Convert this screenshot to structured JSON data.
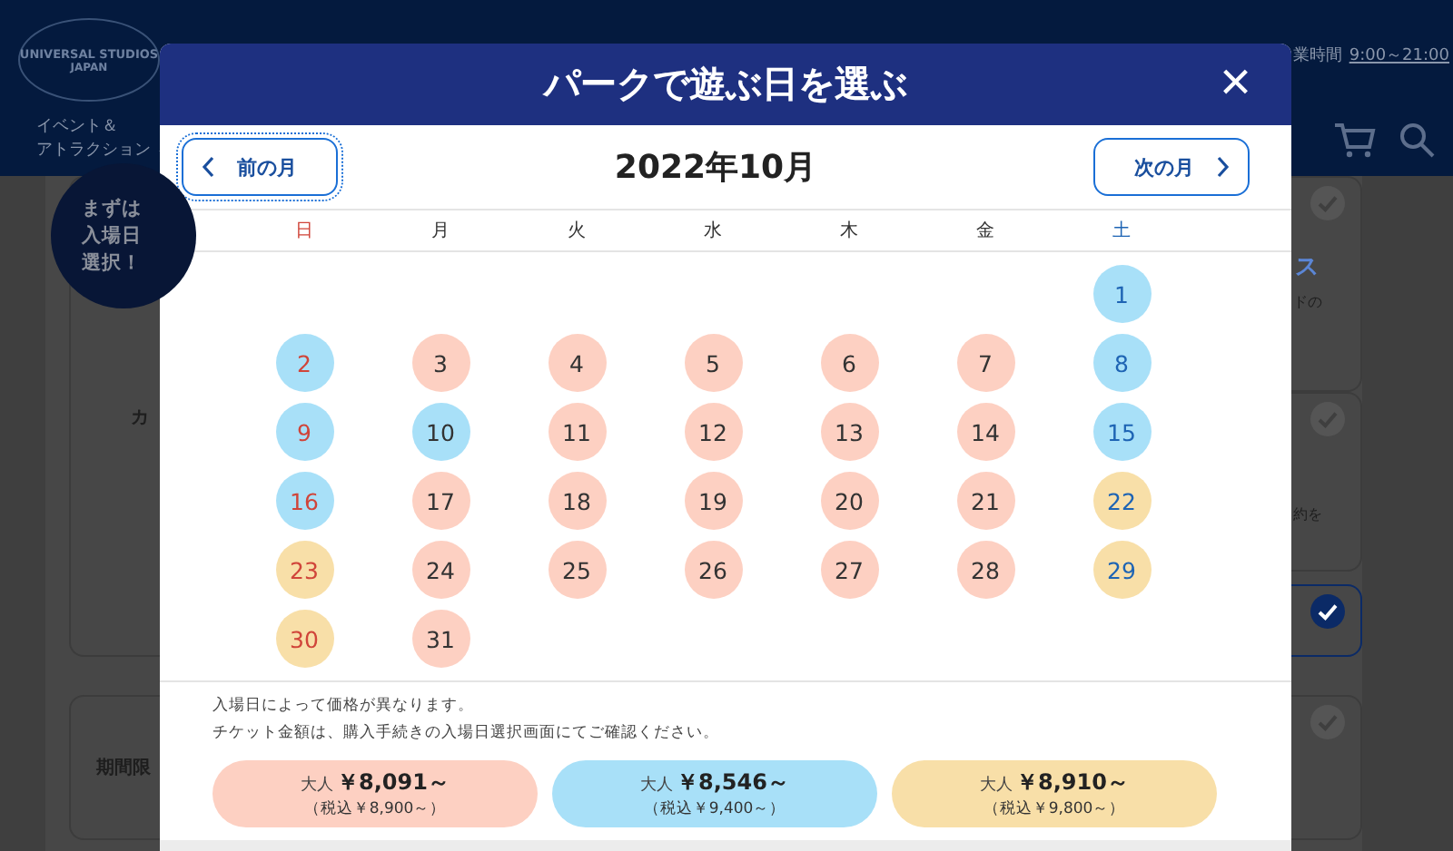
{
  "background_page": {
    "logo": {
      "line_1": "UNIVERSAL STUDIOS",
      "line_2": "JAPAN"
    },
    "hours_label": "業時間",
    "hours": "9:00～21:00",
    "nav_item": {
      "line_1": "イベント＆",
      "line_2": "アトラクション"
    },
    "badge": [
      "まずは",
      "入場日",
      "選択！"
    ],
    "left_cards": [
      "カ",
      "期間限"
    ],
    "right_cards": [
      {
        "title": "ス",
        "note": "ドの",
        "checked": false
      },
      {
        "note": "約を",
        "checked": false
      },
      {
        "checked": true
      },
      {
        "checked": false
      }
    ]
  },
  "dialog": {
    "title": "パークで遊ぶ日を選ぶ",
    "close": "×",
    "prev_button": "前の月",
    "next_button": "次の月",
    "month": "2022年10月",
    "weekdays": [
      {
        "label": "日",
        "kind": "sunday"
      },
      {
        "label": "月",
        "kind": "weekday"
      },
      {
        "label": "火",
        "kind": "weekday"
      },
      {
        "label": "水",
        "kind": "weekday"
      },
      {
        "label": "木",
        "kind": "weekday"
      },
      {
        "label": "金",
        "kind": "weekday"
      },
      {
        "label": "土",
        "kind": "saturday"
      }
    ],
    "days": [
      {
        "label": "1",
        "color": "#a8e0f8"
      },
      {
        "label": "2",
        "color": "#a8e0f8"
      },
      {
        "label": "3",
        "color": "#fdd0c2"
      },
      {
        "label": "4",
        "color": "#fdd0c2"
      },
      {
        "label": "5",
        "color": "#fdd0c2"
      },
      {
        "label": "6",
        "color": "#fdd0c2"
      },
      {
        "label": "7",
        "color": "#fdd0c2"
      },
      {
        "label": "8",
        "color": "#a8e0f8"
      },
      {
        "label": "9",
        "color": "#a8e0f8"
      },
      {
        "label": "10",
        "color": "#a8e0f8"
      },
      {
        "label": "11",
        "color": "#fdd0c2"
      },
      {
        "label": "12",
        "color": "#fdd0c2"
      },
      {
        "label": "13",
        "color": "#fdd0c2"
      },
      {
        "label": "14",
        "color": "#fdd0c2"
      },
      {
        "label": "15",
        "color": "#a8e0f8"
      },
      {
        "label": "16",
        "color": "#a8e0f8"
      },
      {
        "label": "17",
        "color": "#fdd0c2"
      },
      {
        "label": "18",
        "color": "#fdd0c2"
      },
      {
        "label": "19",
        "color": "#fdd0c2"
      },
      {
        "label": "20",
        "color": "#fdd0c2"
      },
      {
        "label": "21",
        "color": "#fdd0c2"
      },
      {
        "label": "22",
        "color": "#f8dfa8"
      },
      {
        "label": "23",
        "color": "#f8dfa8"
      },
      {
        "label": "24",
        "color": "#fdd0c2"
      },
      {
        "label": "25",
        "color": "#fdd0c2"
      },
      {
        "label": "26",
        "color": "#fdd0c2"
      },
      {
        "label": "27",
        "color": "#fdd0c2"
      },
      {
        "label": "28",
        "color": "#fdd0c2"
      },
      {
        "label": "29",
        "color": "#f8dfa8"
      },
      {
        "label": "30",
        "color": "#f8dfa8"
      },
      {
        "label": "31",
        "color": "#fdd0c2"
      }
    ],
    "notes": [
      "入場日によって価格が異なります。",
      "チケット金額は、購入手続きの入場日選択画面にてご確認ください。"
    ],
    "prices": [
      {
        "prefix": "大人",
        "price": "￥8,091～",
        "tax": "（税込￥8,900～）",
        "color": "#fdd0c2"
      },
      {
        "prefix": "大人",
        "price": "￥8,546～",
        "tax": "（税込￥9,400～）",
        "color": "#a8e0f8"
      },
      {
        "prefix": "大人",
        "price": "￥8,910～",
        "tax": "（税込￥9,800～）",
        "color": "#f8dfa8"
      }
    ]
  }
}
